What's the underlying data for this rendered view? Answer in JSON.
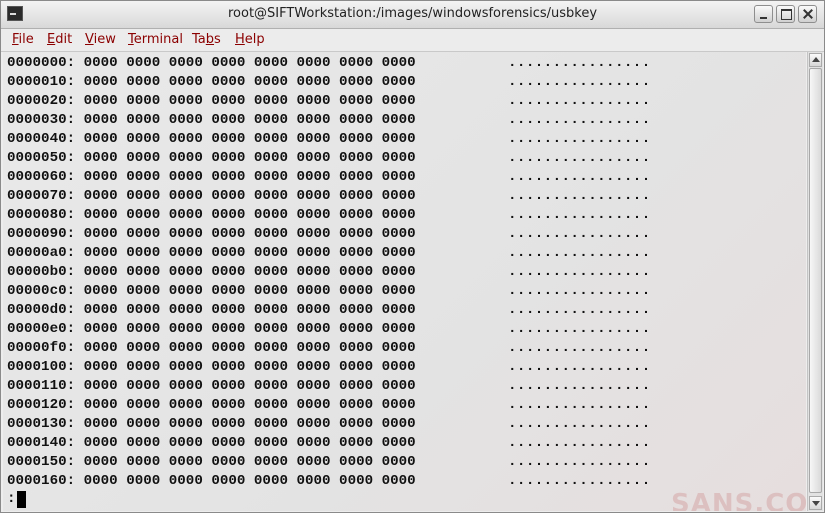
{
  "window": {
    "title": "root@SIFTWorkstation:/images/windowsforensics/usbkey"
  },
  "menu": [
    {
      "pre": "",
      "ul": "F",
      "post": "ile"
    },
    {
      "pre": "",
      "ul": "E",
      "post": "dit"
    },
    {
      "pre": "",
      "ul": "V",
      "post": "iew"
    },
    {
      "pre": "",
      "ul": "T",
      "post": "erminal"
    },
    {
      "pre": "Ta",
      "ul": "b",
      "post": "s"
    },
    {
      "pre": "",
      "ul": "H",
      "post": "elp"
    }
  ],
  "hexdump": {
    "rows": [
      {
        "offset": "0000000:",
        "hex": "0000 0000 0000 0000 0000 0000 0000 0000",
        "ascii": "................"
      },
      {
        "offset": "0000010:",
        "hex": "0000 0000 0000 0000 0000 0000 0000 0000",
        "ascii": "................"
      },
      {
        "offset": "0000020:",
        "hex": "0000 0000 0000 0000 0000 0000 0000 0000",
        "ascii": "................"
      },
      {
        "offset": "0000030:",
        "hex": "0000 0000 0000 0000 0000 0000 0000 0000",
        "ascii": "................"
      },
      {
        "offset": "0000040:",
        "hex": "0000 0000 0000 0000 0000 0000 0000 0000",
        "ascii": "................"
      },
      {
        "offset": "0000050:",
        "hex": "0000 0000 0000 0000 0000 0000 0000 0000",
        "ascii": "................"
      },
      {
        "offset": "0000060:",
        "hex": "0000 0000 0000 0000 0000 0000 0000 0000",
        "ascii": "................"
      },
      {
        "offset": "0000070:",
        "hex": "0000 0000 0000 0000 0000 0000 0000 0000",
        "ascii": "................"
      },
      {
        "offset": "0000080:",
        "hex": "0000 0000 0000 0000 0000 0000 0000 0000",
        "ascii": "................"
      },
      {
        "offset": "0000090:",
        "hex": "0000 0000 0000 0000 0000 0000 0000 0000",
        "ascii": "................"
      },
      {
        "offset": "00000a0:",
        "hex": "0000 0000 0000 0000 0000 0000 0000 0000",
        "ascii": "................"
      },
      {
        "offset": "00000b0:",
        "hex": "0000 0000 0000 0000 0000 0000 0000 0000",
        "ascii": "................"
      },
      {
        "offset": "00000c0:",
        "hex": "0000 0000 0000 0000 0000 0000 0000 0000",
        "ascii": "................"
      },
      {
        "offset": "00000d0:",
        "hex": "0000 0000 0000 0000 0000 0000 0000 0000",
        "ascii": "................"
      },
      {
        "offset": "00000e0:",
        "hex": "0000 0000 0000 0000 0000 0000 0000 0000",
        "ascii": "................"
      },
      {
        "offset": "00000f0:",
        "hex": "0000 0000 0000 0000 0000 0000 0000 0000",
        "ascii": "................"
      },
      {
        "offset": "0000100:",
        "hex": "0000 0000 0000 0000 0000 0000 0000 0000",
        "ascii": "................"
      },
      {
        "offset": "0000110:",
        "hex": "0000 0000 0000 0000 0000 0000 0000 0000",
        "ascii": "................"
      },
      {
        "offset": "0000120:",
        "hex": "0000 0000 0000 0000 0000 0000 0000 0000",
        "ascii": "................"
      },
      {
        "offset": "0000130:",
        "hex": "0000 0000 0000 0000 0000 0000 0000 0000",
        "ascii": "................"
      },
      {
        "offset": "0000140:",
        "hex": "0000 0000 0000 0000 0000 0000 0000 0000",
        "ascii": "................"
      },
      {
        "offset": "0000150:",
        "hex": "0000 0000 0000 0000 0000 0000 0000 0000",
        "ascii": "................"
      },
      {
        "offset": "0000160:",
        "hex": "0000 0000 0000 0000 0000 0000 0000 0000",
        "ascii": "................"
      }
    ]
  },
  "prompt": ":",
  "watermark": "SANS.CO",
  "colors": {
    "menu_text": "#8b0000",
    "terminal_fg": "#111111",
    "terminal_bg": "#e7e7e7"
  },
  "icons": {
    "app": "terminal-icon",
    "minimize": "minimize-icon",
    "maximize": "maximize-icon",
    "close": "close-icon"
  }
}
